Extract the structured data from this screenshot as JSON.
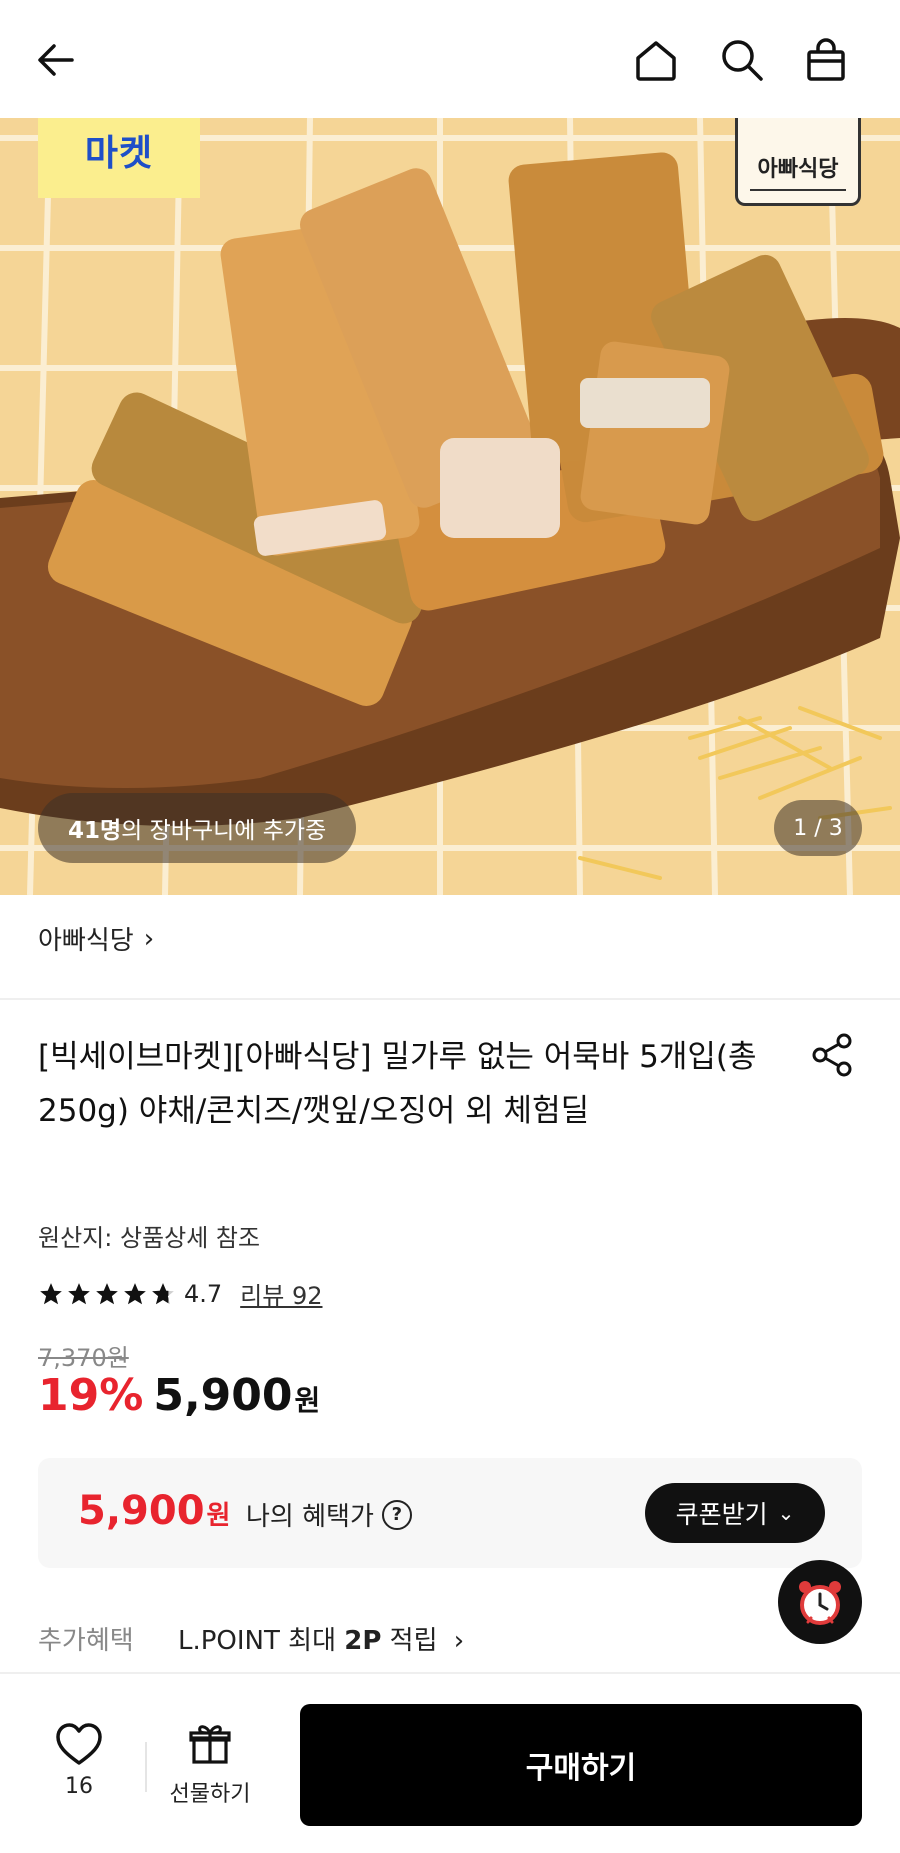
{
  "header": {
    "back_icon": "arrow-left-icon",
    "home_icon": "home-icon",
    "search_icon": "search-icon",
    "cart_icon": "shopping-bag-icon"
  },
  "hero": {
    "badge_text": "마켓",
    "brand_logo_text": "아빠식당",
    "cart_count": "41명",
    "cart_text": "의 장바구니에 추가중",
    "page_indicator": "1 / 3"
  },
  "store": {
    "name": "아빠식당",
    "chevron": "›"
  },
  "product": {
    "title": "[빅세이브마켓][아빠식당] 밀가루 없는 어묵바 5개입(총250g) 야채/콘치즈/깻잎/오징어 외 체험딜",
    "origin": "원산지: 상품상세 참조",
    "rating_value": "4.7",
    "rating_stars": 4.7,
    "reviews": "리뷰 92",
    "original_price": "7,370원",
    "discount": "19%",
    "price": "5,900",
    "price_unit": "원"
  },
  "benefit": {
    "price": "5,900",
    "unit": "원",
    "label": "나의 혜택가",
    "help": "?",
    "coupon_button": "쿠폰받기",
    "coupon_chevron": "⌄"
  },
  "extra": {
    "label": "추가혜택",
    "text_prefix": "L.POINT 최대 ",
    "text_bold": "2P",
    "text_suffix": " 적립",
    "chevron": "›"
  },
  "bottom": {
    "like_count": "16",
    "gift_label": "선물하기",
    "buy_label": "구매하기"
  },
  "colors": {
    "accent_red": "#e8242e",
    "button_black": "#000000",
    "badge_yellow": "#fbee8e",
    "badge_text_blue": "#1e4fc8"
  }
}
